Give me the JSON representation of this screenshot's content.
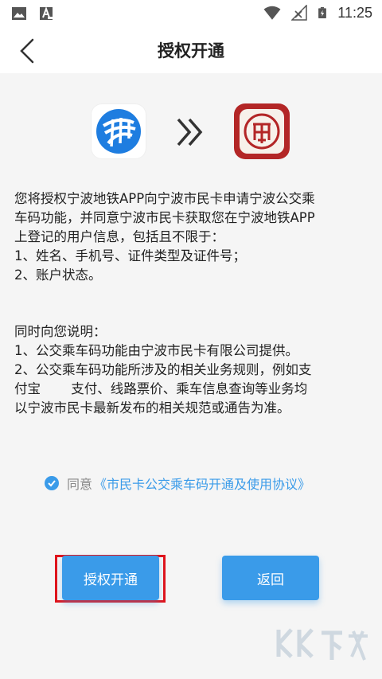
{
  "status_bar": {
    "time": "11:25",
    "icons": [
      "image-icon",
      "font-icon",
      "wifi-icon",
      "no-signal-icon",
      "battery-charging-icon"
    ]
  },
  "header": {
    "title": "授权开通",
    "back_icon": "chevron-left-icon"
  },
  "logos": {
    "left": "metro-app-logo",
    "middle": "double-chevron-right-icon",
    "right": "citizen-card-logo"
  },
  "paragraph1": [
    "您将授权宁波地铁APP向宁波市民卡申请宁波公交乘",
    "车码功能，并同意宁波市民卡获取您在宁波地铁APP",
    "上登记的用户信息，包括且不限于：",
    "1、姓名、手机号、证件类型及证件号；",
    "2、账户状态。"
  ],
  "paragraph2": [
    "同时向您说明：",
    "1、公交乘车码功能由宁波市民卡有限公司提供。",
    "2、公交乘车码功能所涉及的相关业务规则，例如支",
    "付宝　　 支付、线路票价、乘车信息查询等业务均",
    "以宁波市民卡最新发布的相关规范或通告为准。"
  ],
  "agreement": {
    "prefix": "同意",
    "link": "《市民卡公交乘车码开通及使用协议》",
    "checked": true
  },
  "buttons": {
    "authorize": "授权开通",
    "back": "返回"
  },
  "colors": {
    "accent": "#3a9be9",
    "highlight_border": "#e0141c",
    "card_red": "#b32626"
  }
}
